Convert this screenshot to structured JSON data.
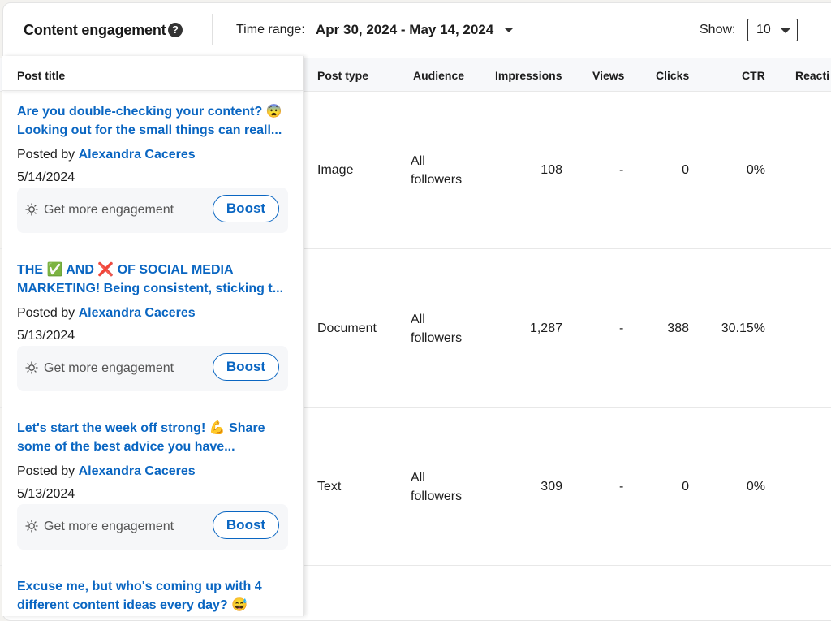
{
  "header": {
    "title": "Content engagement",
    "time_range_label": "Time range:",
    "time_range_value": "Apr 30, 2024 - May 14, 2024",
    "show_label": "Show:",
    "show_value": "10"
  },
  "columns": [
    "Post title",
    "Post type",
    "Audience",
    "Impressions",
    "Views",
    "Clicks",
    "CTR",
    "Reacti"
  ],
  "posts": [
    {
      "title_line1": "Are you double-checking your content? 😨",
      "title_line2": "Looking out for the small things can reall...",
      "posted_by_label": "Posted by",
      "author": "Alexandra Caceres",
      "date": "5/14/2024",
      "engage_label": "Get more engagement",
      "boost_label": "Boost",
      "type": "Image",
      "audience_line1": "All",
      "audience_line2": "followers",
      "impressions": "108",
      "views": "-",
      "clicks": "0",
      "ctr": "0%"
    },
    {
      "title_line1": "THE ✅ AND ❌ OF SOCIAL MEDIA",
      "title_line2": "MARKETING! Being consistent, sticking t...",
      "posted_by_label": "Posted by",
      "author": "Alexandra Caceres",
      "date": "5/13/2024",
      "engage_label": "Get more engagement",
      "boost_label": "Boost",
      "type": "Document",
      "audience_line1": "All",
      "audience_line2": "followers",
      "impressions": "1,287",
      "views": "-",
      "clicks": "388",
      "ctr": "30.15%"
    },
    {
      "title_line1": "Let's start the week off strong! 💪 Share",
      "title_line2": "some of the best advice you have...",
      "posted_by_label": "Posted by",
      "author": "Alexandra Caceres",
      "date": "5/13/2024",
      "engage_label": "Get more engagement",
      "boost_label": "Boost",
      "type": "Text",
      "audience_line1": "All",
      "audience_line2": "followers",
      "impressions": "309",
      "views": "-",
      "clicks": "0",
      "ctr": "0%"
    },
    {
      "title_line1": "Excuse me, but who's coming up with 4",
      "title_line2": "different content ideas every day? 😅"
    }
  ]
}
